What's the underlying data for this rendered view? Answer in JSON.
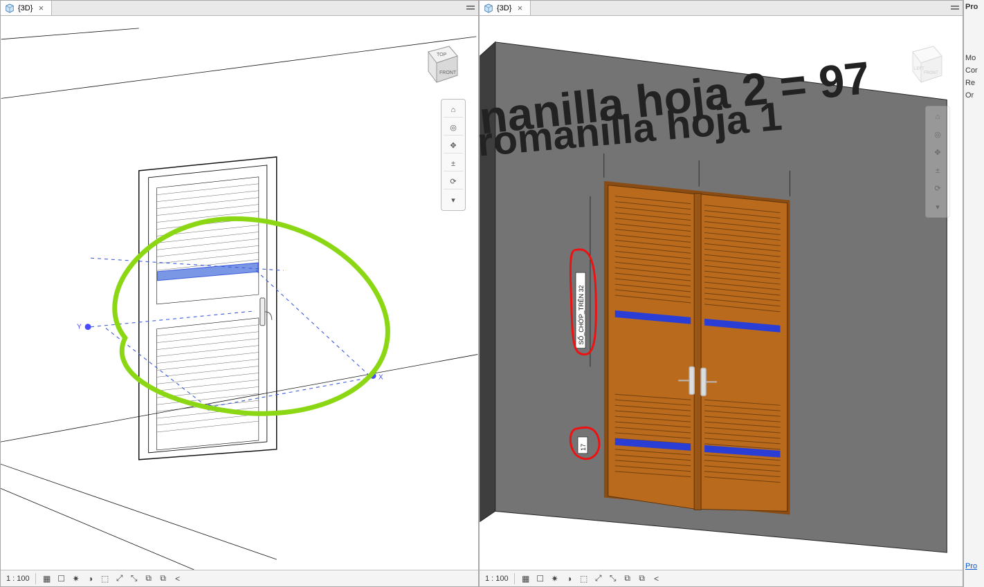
{
  "panes": {
    "left": {
      "tab_icon": "3d-cube-icon",
      "tab_label": "{3D}",
      "scale_label": "1 : 100",
      "viewcube": {
        "top": "TOP",
        "front": "FRONT"
      },
      "axes": {
        "x": "X",
        "y": "Y"
      }
    },
    "right": {
      "tab_icon": "3d-cube-icon",
      "tab_label": "{3D}",
      "scale_label": "1 : 100",
      "viewcube": {
        "left": "LEFT",
        "front": "FRONT"
      },
      "overlay_upper": "nanilla hoja 2 = 97",
      "overlay_lower": "romanilla hoja 1",
      "dim_upper_label": "SỐ_CHỚP_TRÊN 32",
      "dim_lower_label": "17"
    }
  },
  "properties_strip": {
    "title": "Pro",
    "rows": [
      "Mo",
      "Cor",
      "Re",
      "Or"
    ],
    "link": "Pro"
  },
  "navtool_glyphs": [
    "⌂",
    "✥",
    "·",
    "⟳",
    "↔",
    "▾"
  ],
  "viewctl_glyphs_left": [
    "▦",
    "☐",
    "⬚",
    "✹",
    "⤴",
    "⤵",
    "↺",
    "↻",
    "⧉",
    "⧉",
    "<"
  ],
  "viewctl_glyphs_right": [
    "▦",
    "☐",
    "⬚",
    "✹",
    "⤴",
    "⤵",
    "↺",
    "↻",
    "⧉",
    "⧉",
    "<"
  ],
  "colors": {
    "door_wood": "#b96a1d",
    "door_louver": "#c77a2b",
    "wall_gray": "#747474",
    "accent_blue": "#3b5bdc",
    "markup_green": "#8bd713",
    "markup_red": "#e11"
  }
}
